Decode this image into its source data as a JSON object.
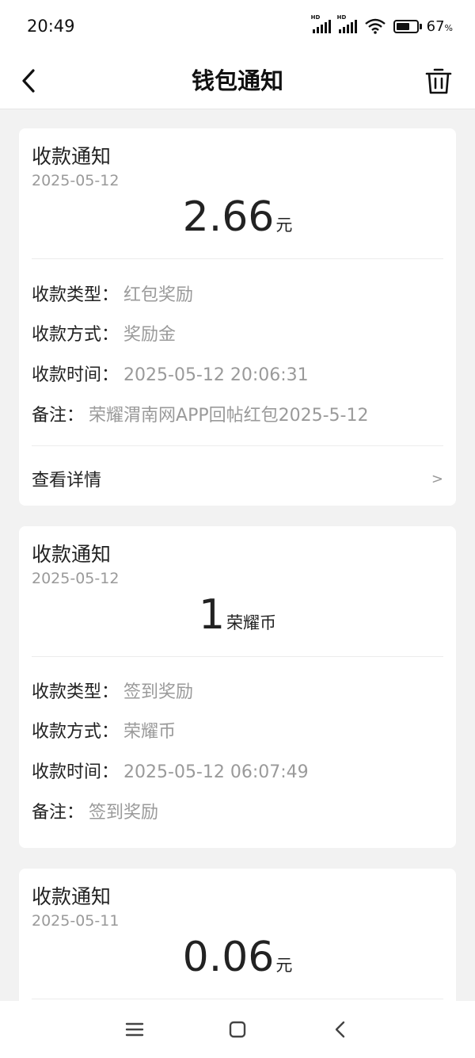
{
  "status_bar": {
    "time": "20:49",
    "battery_pct": "67",
    "battery_unit": "%",
    "battery_level": 0.67,
    "hd": "HD"
  },
  "nav": {
    "title": "钱包通知"
  },
  "cards": [
    {
      "title": "收款通知",
      "date": "2025-05-12",
      "amount": "2.66",
      "unit": "元",
      "rows": [
        {
          "label": "收款类型：",
          "value": "红包奖励"
        },
        {
          "label": "收款方式：",
          "value": "奖励金"
        },
        {
          "label": "收款时间：",
          "value": "2025-05-12 20:06:31"
        },
        {
          "label": "备注：",
          "value": "荣耀渭南网APP回帖红包2025-5-12"
        }
      ],
      "detail_label": "查看详情",
      "detail_arrow": ">"
    },
    {
      "title": "收款通知",
      "date": "2025-05-12",
      "amount": "1",
      "unit": "荣耀币",
      "rows": [
        {
          "label": "收款类型：",
          "value": "签到奖励"
        },
        {
          "label": "收款方式：",
          "value": "荣耀币"
        },
        {
          "label": "收款时间：",
          "value": "2025-05-12 06:07:49"
        },
        {
          "label": "备注：",
          "value": "签到奖励"
        }
      ]
    },
    {
      "title": "收款通知",
      "date": "2025-05-11",
      "amount": "0.06",
      "unit": "元"
    }
  ]
}
